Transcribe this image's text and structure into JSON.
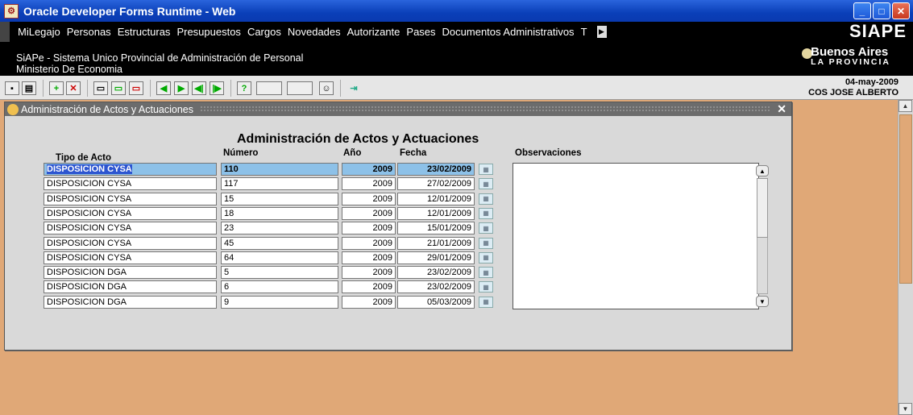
{
  "window": {
    "title": "Oracle Developer Forms Runtime - Web",
    "buttons": [
      "_",
      "□",
      "✕"
    ]
  },
  "menu": {
    "items": [
      "MiLegajo",
      "Personas",
      "Estructuras",
      "Presupuestos",
      "Cargos",
      "Novedades",
      "Autorizante",
      "Pases",
      "Documentos Administrativos",
      "T"
    ],
    "brand": "SIAPE"
  },
  "banner": {
    "line1": "SiAPe - Sistema Unico Provincial de Administración de Personal",
    "line2": "Ministerio De Economia",
    "logo_main": "Buenos Aires",
    "logo_sub": "LA PROVINCIA"
  },
  "toolbar": {
    "date": "04-may-2009",
    "user": "COS JOSE ALBERTO",
    "icons": [
      "save-icon",
      "print-icon",
      "add-icon",
      "delete-icon",
      "query-icon",
      "execute-query-icon",
      "cancel-query-icon",
      "first-record-icon",
      "next-record-icon",
      "previous-block-icon",
      "next-block-icon",
      "help-icon",
      "blank-1",
      "blank-2",
      "user-icon",
      "exit-icon"
    ]
  },
  "form": {
    "title": "Administración de Actos y Actuaciones",
    "heading": "Administración de Actos y Actuaciones",
    "columns": {
      "tipo": "Tipo de Acto",
      "numero": "Número",
      "anio": "Año",
      "fecha": "Fecha",
      "obs": "Observaciones"
    },
    "rows": [
      {
        "tipo": "DISPOSICION CYSA",
        "numero": "110",
        "anio": "2009",
        "fecha": "23/02/2009"
      },
      {
        "tipo": "DISPOSICION CYSA",
        "numero": "117",
        "anio": "2009",
        "fecha": "27/02/2009"
      },
      {
        "tipo": "DISPOSICION CYSA",
        "numero": "15",
        "anio": "2009",
        "fecha": "12/01/2009"
      },
      {
        "tipo": "DISPOSICION CYSA",
        "numero": "18",
        "anio": "2009",
        "fecha": "12/01/2009"
      },
      {
        "tipo": "DISPOSICION CYSA",
        "numero": "23",
        "anio": "2009",
        "fecha": "15/01/2009"
      },
      {
        "tipo": "DISPOSICION CYSA",
        "numero": "45",
        "anio": "2009",
        "fecha": "21/01/2009"
      },
      {
        "tipo": "DISPOSICION CYSA",
        "numero": "64",
        "anio": "2009",
        "fecha": "29/01/2009"
      },
      {
        "tipo": "DISPOSICION DGA",
        "numero": "5",
        "anio": "2009",
        "fecha": "23/02/2009"
      },
      {
        "tipo": "DISPOSICION DGA",
        "numero": "6",
        "anio": "2009",
        "fecha": "23/02/2009"
      },
      {
        "tipo": "DISPOSICION DGA",
        "numero": "9",
        "anio": "2009",
        "fecha": "05/03/2009"
      }
    ],
    "observaciones": ""
  },
  "colors": {
    "background": "#e0a877",
    "titlebar": "#0a3fb8",
    "selected_row": "#8dc1e8",
    "selected_name": "#2d55d0"
  }
}
